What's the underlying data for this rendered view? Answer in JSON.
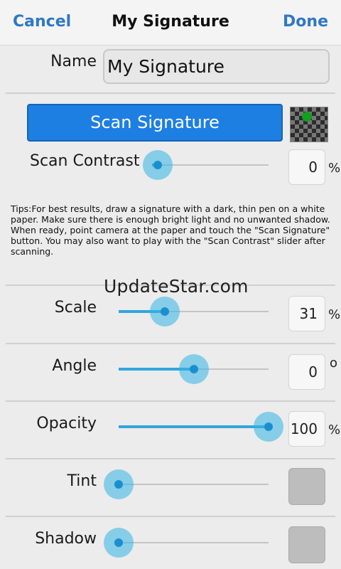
{
  "header": {
    "cancel_label": "Cancel",
    "title": "My Signature",
    "done_label": "Done"
  },
  "name": {
    "label": "Name",
    "value": "My Signature"
  },
  "scan": {
    "button_label": "Scan Signature",
    "contrast_label": "Scan Contrast",
    "contrast_value": "0",
    "contrast_unit": "%",
    "contrast_level": 0.05,
    "preview_dot_color": "#11a020"
  },
  "tips": "Tips:For best results, draw a signature with a dark, thin pen on a white paper. Make sure there is enough bright light and no unwanted shadow. When ready, point camera at the paper and touch the \"Scan Signature\" button. You may also want to play with the \"Scan Contrast\" slider after scanning.",
  "watermark": "UpdateStar.com",
  "adjust": {
    "scale": {
      "label": "Scale",
      "value": "31",
      "unit": "%",
      "level": 0.31
    },
    "angle": {
      "label": "Angle",
      "value": "0",
      "unit": "o",
      "level": 0.5
    },
    "opacity": {
      "label": "Opacity",
      "value": "100",
      "unit": "%",
      "level": 1.0
    },
    "tint": {
      "label": "Tint",
      "level": 0.0,
      "swatch_color": "#bdbdbd"
    },
    "shadow": {
      "label": "Shadow",
      "level": 0.0,
      "swatch_color": "#bdbdbd"
    }
  },
  "colors": {
    "accent": "#2f78c4",
    "button": "#1e7fe3",
    "slider": "#33a5dc"
  }
}
